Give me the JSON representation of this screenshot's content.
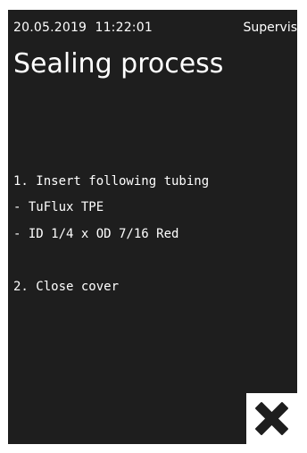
{
  "status_bar": {
    "timestamp": "20.05.2019  11:22:01",
    "user_role": "Supervis"
  },
  "page_title": "Sealing process",
  "instructions": [
    "1. Insert following tubing",
    "- TuFlux TPE",
    "- ID 1/4 x OD 7/16 Red",
    "2. Close cover"
  ],
  "close_button": {
    "icon": "close-icon"
  },
  "colors": {
    "screen_background": "#1e1e1e",
    "text": "#ffffff",
    "close_button_background": "#ffffff",
    "close_icon": "#1e1e1e"
  }
}
